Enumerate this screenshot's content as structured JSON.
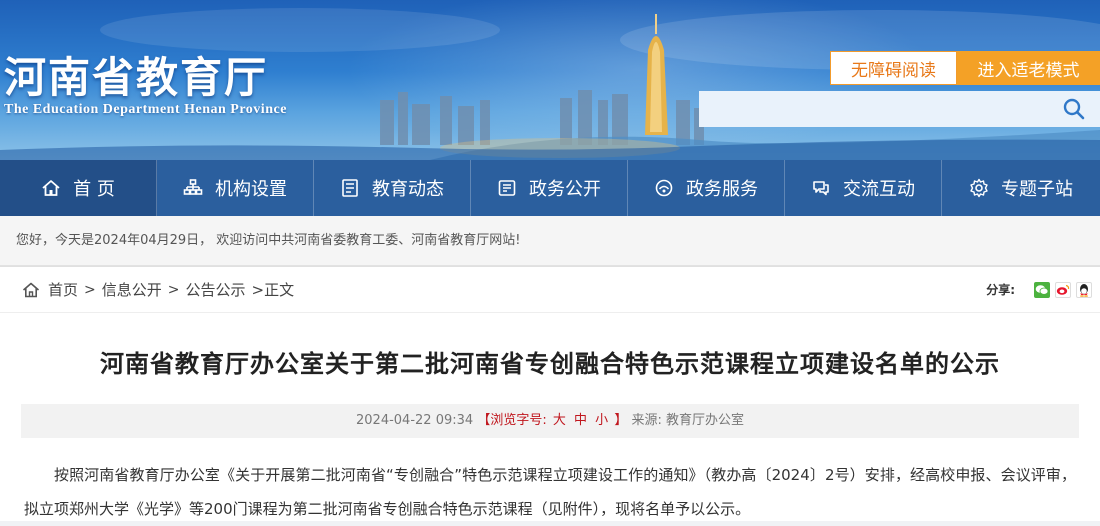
{
  "header": {
    "logo_cn": "河南省教育厅",
    "logo_en": "The Education Department Henan Province",
    "accessibility_label": "无障碍阅读",
    "elder_mode_label": "进入适老模式",
    "search_placeholder": "",
    "accent_orange": "#f4a126"
  },
  "nav": {
    "items": [
      {
        "label": "首 页",
        "icon": "home-icon"
      },
      {
        "label": "机构设置",
        "icon": "org-chart-icon"
      },
      {
        "label": "教育动态",
        "icon": "news-list-icon"
      },
      {
        "label": "政务公开",
        "icon": "document-icon"
      },
      {
        "label": "政务服务",
        "icon": "service-icon"
      },
      {
        "label": "交流互动",
        "icon": "interaction-icon"
      },
      {
        "label": "专题子站",
        "icon": "topic-gear-icon"
      }
    ],
    "color": "#2b5f9e"
  },
  "welcome": "您好，今天是2024年04月29日， 欢迎访问中共河南省委教育工委、河南省教育厅网站!",
  "breadcrumb": {
    "items": [
      "首页",
      "信息公开",
      "公告公示"
    ],
    "sep": ">",
    "current": ">正文"
  },
  "share": {
    "label": "分享:",
    "targets": [
      "wechat-icon",
      "weibo-icon",
      "qq-icon"
    ]
  },
  "article": {
    "title": "河南省教育厅办公室关于第二批河南省专创融合特色示范课程立项建设名单的公示",
    "date": "2024-04-22 09:34",
    "font_size_prefix": "【浏览字号:",
    "font_sizes": [
      "大",
      "中",
      "小"
    ],
    "font_size_suffix": "】",
    "source": "来源: 教育厅办公室",
    "paragraph": "按照河南省教育厅办公室《关于开展第二批河南省“专创融合”特色示范课程立项建设工作的通知》（教办高〔2024〕2号）安排，经高校申报、会议评审，拟立项郑州大学《光学》等200门课程为第二批河南省专创融合特色示范课程（见附件），现将名单予以公示。"
  }
}
